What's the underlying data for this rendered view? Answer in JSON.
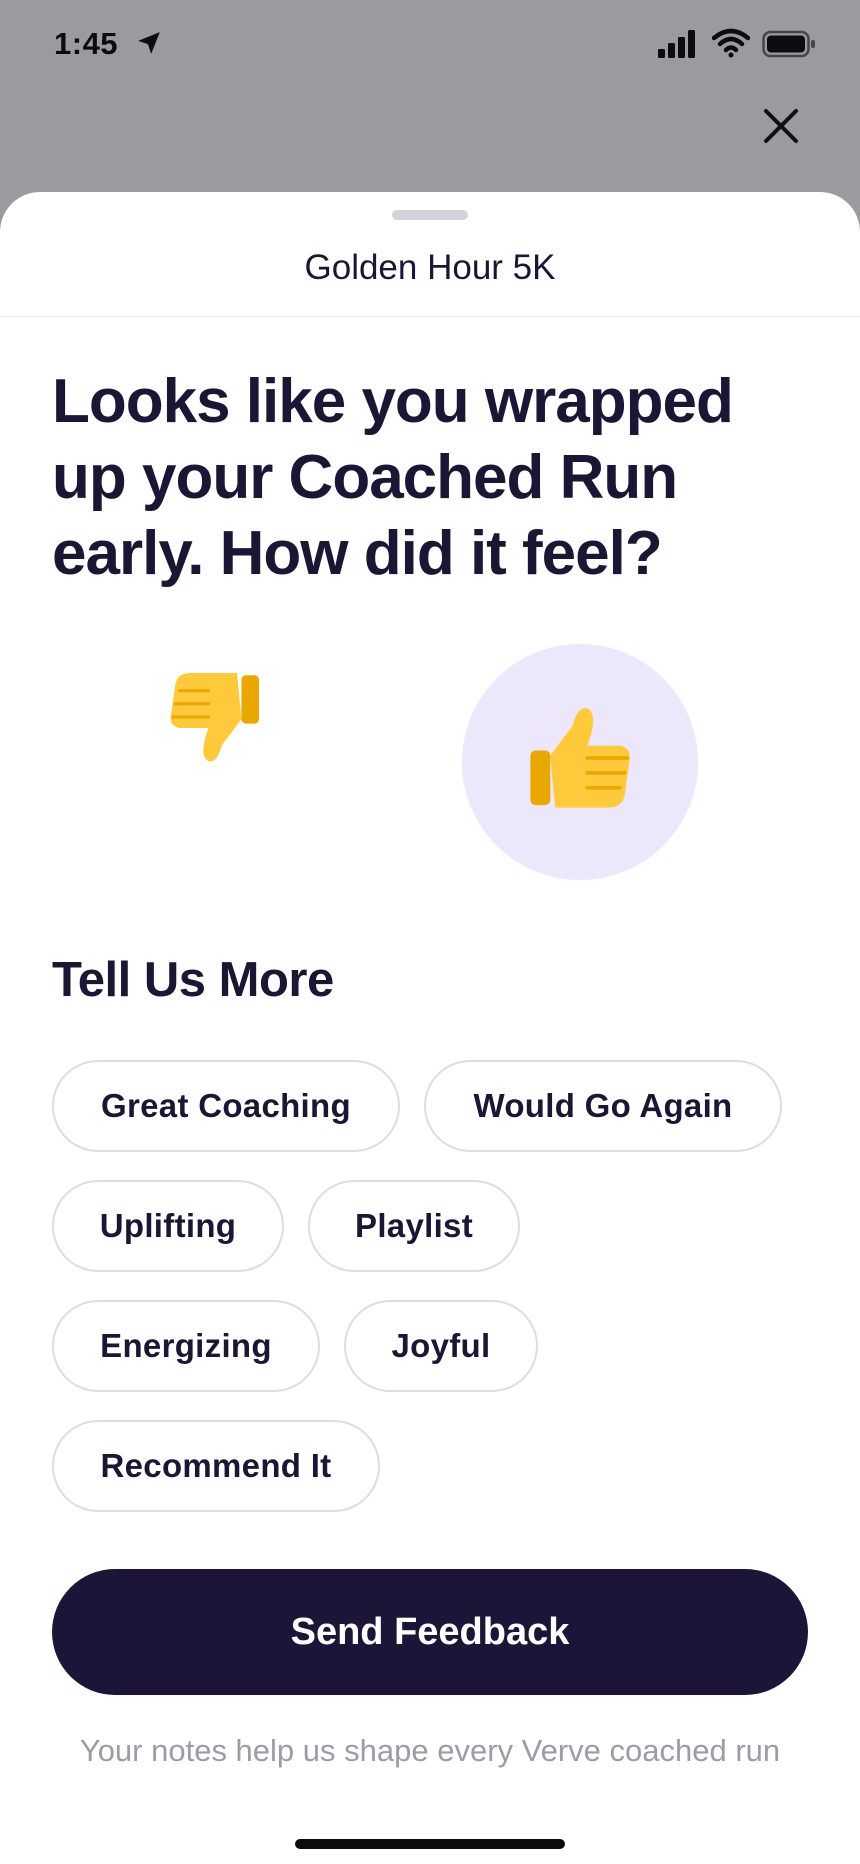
{
  "status_bar": {
    "time": "1:45"
  },
  "sheet": {
    "title": "Golden Hour 5K",
    "headline": "Looks like you wrapped up your Coached Run early. How did it feel?",
    "rating": {
      "selected": "thumbs-up"
    },
    "tell_more": {
      "title": "Tell Us More",
      "chips": [
        "Great Coaching",
        "Would Go Again",
        "Uplifting",
        "Playlist",
        "Energizing",
        "Joyful",
        "Recommend It"
      ]
    },
    "send_label": "Send Feedback",
    "footnote": "Your notes help us shape every Verve coached run"
  },
  "colors": {
    "primary_dark": "#1c1537",
    "selected_bg": "#ece7fb",
    "chip_border": "#dcdce2",
    "muted_text": "#9c9ca6"
  }
}
